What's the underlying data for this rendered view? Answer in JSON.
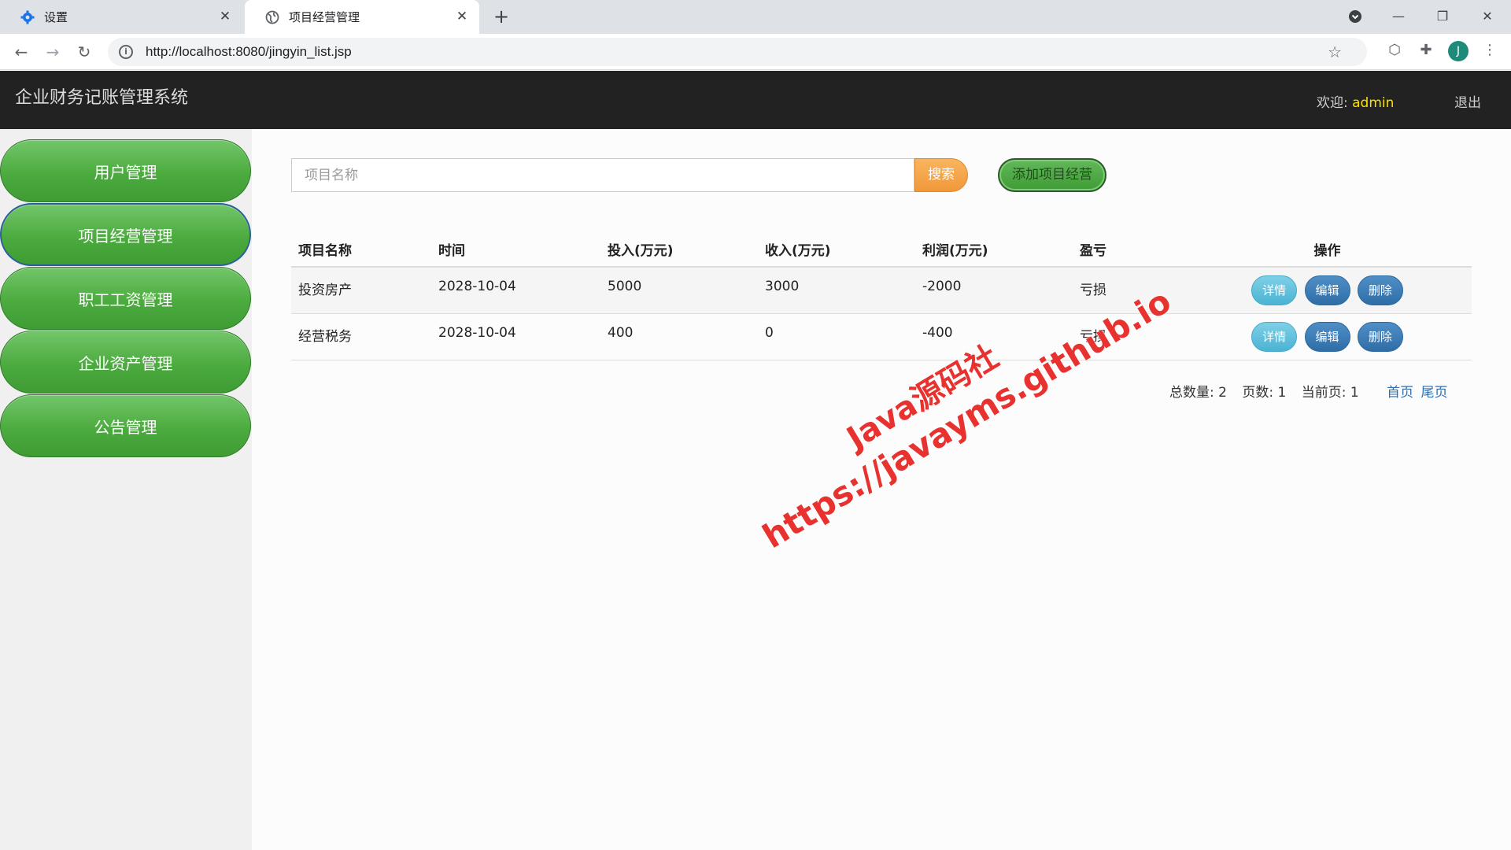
{
  "browser": {
    "tabs": [
      {
        "title": "设置",
        "icon": "gear-icon"
      },
      {
        "title": "项目经营管理",
        "icon": "globe-icon"
      }
    ],
    "url": "http://localhost:8080/jingyin_list.jsp",
    "profile_initial": "J"
  },
  "header": {
    "app_title": "企业财务记账管理系统",
    "welcome_label": "欢迎:",
    "username": "admin",
    "logout_label": "退出"
  },
  "sidebar": {
    "items": [
      {
        "label": "用户管理"
      },
      {
        "label": "项目经营管理"
      },
      {
        "label": "职工工资管理"
      },
      {
        "label": "企业资产管理"
      },
      {
        "label": "公告管理"
      }
    ]
  },
  "search": {
    "placeholder": "项目名称",
    "value": "",
    "search_label": "搜索",
    "add_label": "添加项目经营"
  },
  "table": {
    "columns": [
      "项目名称",
      "时间",
      "投入(万元)",
      "收入(万元)",
      "利润(万元)",
      "盈亏",
      "操作"
    ],
    "rows": [
      {
        "name": "投资房产",
        "date": "2028-10-04",
        "input": "5000",
        "income": "3000",
        "profit": "-2000",
        "status": "亏损"
      },
      {
        "name": "经营税务",
        "date": "2028-10-04",
        "input": "400",
        "income": "0",
        "profit": "-400",
        "status": "亏损"
      }
    ],
    "actions": {
      "detail": "详情",
      "edit": "编辑",
      "delete": "删除"
    }
  },
  "pager": {
    "total_label": "总数量:",
    "total": "2",
    "pages_label": "页数:",
    "pages": "1",
    "current_label": "当前页:",
    "current": "1",
    "first_label": "首页",
    "last_label": "尾页"
  },
  "watermark": {
    "line1": "Java源码社",
    "line2": "https://javayms.github.io"
  },
  "colors": {
    "header_bg": "#222222",
    "username": "#f7e300",
    "sidebar_button": "#4cab3f",
    "search_button": "#f0983a",
    "detail_button": "#4bb3d4",
    "edit_button": "#2f6da7",
    "watermark": "#e8322f"
  }
}
